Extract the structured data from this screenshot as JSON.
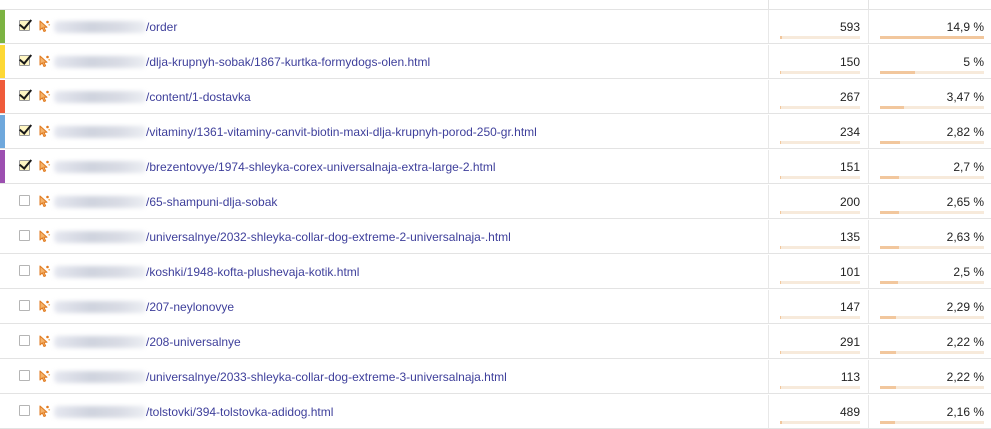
{
  "table": {
    "rows": [
      {
        "checked": true,
        "color": "#7cb342",
        "path": "/order",
        "count": "593",
        "pct": "14,9 %",
        "count_share": 0.03,
        "pct_share": 1.0
      },
      {
        "checked": true,
        "color": "#fdd835",
        "path": "/dlja-krupnyh-sobak/1867-kurtka-formydogs-olen.html",
        "count": "150",
        "pct": "5 %",
        "count_share": 0.01,
        "pct_share": 0.34
      },
      {
        "checked": true,
        "color": "#ef5b3b",
        "path": "/content/1-dostavka",
        "count": "267",
        "pct": "3,47 %",
        "count_share": 0.015,
        "pct_share": 0.23
      },
      {
        "checked": true,
        "color": "#6fa8dc",
        "path": "/vitaminy/1361-vitaminy-canvit-biotin-maxi-dlja-krupnyh-porod-250-gr.html",
        "count": "234",
        "pct": "2,82 %",
        "count_share": 0.013,
        "pct_share": 0.19
      },
      {
        "checked": true,
        "color": "#9c4fb0",
        "path": "/brezentovye/1974-shleyka-corex-universalnaja-extra-large-2.html",
        "count": "151",
        "pct": "2,7 %",
        "count_share": 0.01,
        "pct_share": 0.18
      },
      {
        "checked": false,
        "color": "",
        "path": "/65-shampuni-dlja-sobak",
        "count": "200",
        "pct": "2,65 %",
        "count_share": 0.012,
        "pct_share": 0.18
      },
      {
        "checked": false,
        "color": "",
        "path": "/universalnye/2032-shleyka-collar-dog-extreme-2-universalnaja-.html",
        "count": "135",
        "pct": "2,63 %",
        "count_share": 0.01,
        "pct_share": 0.18
      },
      {
        "checked": false,
        "color": "",
        "path": "/koshki/1948-kofta-plushevaja-kotik.html",
        "count": "101",
        "pct": "2,5 %",
        "count_share": 0.008,
        "pct_share": 0.17
      },
      {
        "checked": false,
        "color": "",
        "path": "/207-neylonovye",
        "count": "147",
        "pct": "2,29 %",
        "count_share": 0.01,
        "pct_share": 0.15
      },
      {
        "checked": false,
        "color": "",
        "path": "/208-universalnye",
        "count": "291",
        "pct": "2,22 %",
        "count_share": 0.016,
        "pct_share": 0.15
      },
      {
        "checked": false,
        "color": "",
        "path": "/universalnye/2033-shleyka-collar-dog-extreme-3-universalnaja.html",
        "count": "113",
        "pct": "2,22 %",
        "count_share": 0.009,
        "pct_share": 0.15
      },
      {
        "checked": false,
        "color": "",
        "path": "/tolstovki/394-tolstovka-adidog.html",
        "count": "489",
        "pct": "2,16 %",
        "count_share": 0.025,
        "pct_share": 0.145
      }
    ]
  },
  "icons": {
    "row_symbol": "cursor-sparkle-icon",
    "masked_domain": "blurred-domain"
  },
  "colors": {
    "link": "#3e3f9b",
    "bar_fill": "#f2c79d",
    "bar_track": "#f7eadb",
    "checkbox_checked_bg": "#fff6c2"
  }
}
